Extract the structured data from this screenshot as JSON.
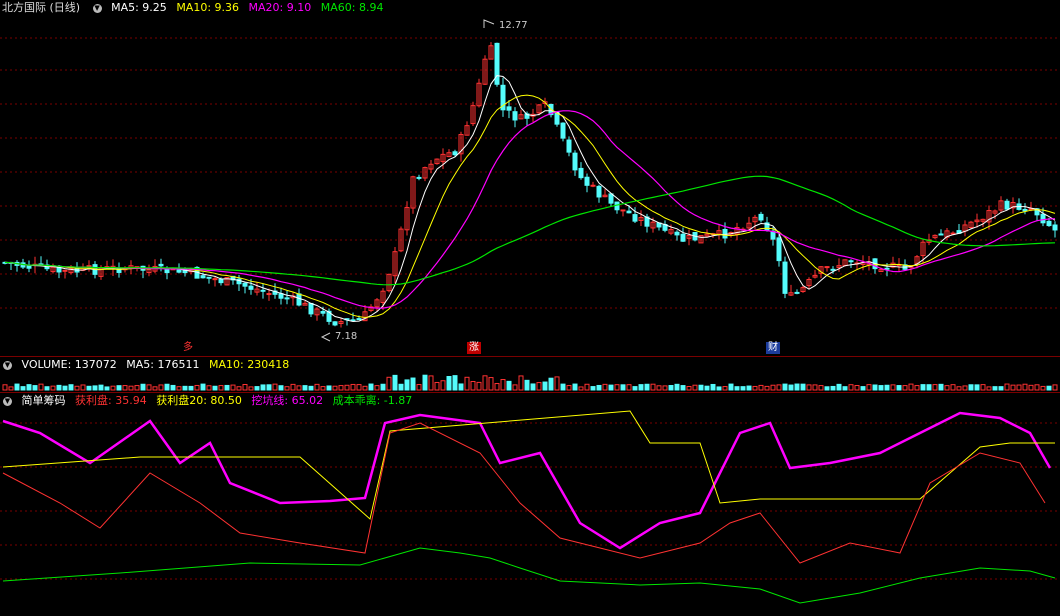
{
  "main": {
    "title": "北方国际 (日线)",
    "ma5": "MA5: 9.25",
    "ma10": "MA10: 9.36",
    "ma20": "MA20: 9.10",
    "ma60": "MA60: 8.94",
    "high_label": "12.77",
    "low_label": "7.18",
    "markers": [
      "多",
      "涨",
      "财"
    ]
  },
  "volume": {
    "label": "VOLUME: 137072",
    "ma5": "MA5: 176511",
    "ma10": "MA10: 230418"
  },
  "chips": {
    "title": "简单筹码",
    "profit": "获利盘: 35.94",
    "profit20": "获利盘20: 80.50",
    "dig": "挖坑线: 65.02",
    "deviation": "成本乖离: -1.87"
  },
  "colors": {
    "up": "#ff3232",
    "down": "#54fcfc",
    "ma5": "#ffffff",
    "ma10": "#ffff00",
    "ma20": "#ff00ff",
    "ma60": "#00e600",
    "grid": "#7a0000"
  },
  "icons": [
    "chevron-down-icon"
  ]
}
